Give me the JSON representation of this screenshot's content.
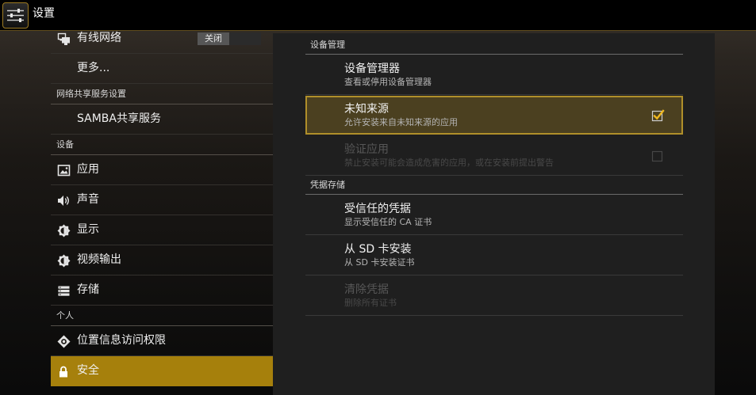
{
  "action_bar": {
    "title": "设置",
    "icon": "settings-icon"
  },
  "colors": {
    "accent": "#a6800c",
    "focus_border": "#b08f2a",
    "focus_fill": "#4b4020",
    "check": "#f0b820",
    "panel": "#1f1f1f",
    "action_bar": "#000000"
  },
  "sidebar": {
    "wired": {
      "label": "有线网络",
      "icon": "ethernet-icon",
      "switch_label": "关闭",
      "switch_on": false
    },
    "more": {
      "label": "更多..."
    },
    "sharing_header": "网络共享服务设置",
    "samba": {
      "label": "SAMBA共享服务"
    },
    "device_header": "设备",
    "apps": {
      "label": "应用",
      "icon": "picture-icon"
    },
    "sound": {
      "label": "声音",
      "icon": "speaker-icon"
    },
    "display": {
      "label": "显示",
      "icon": "brightness-icon"
    },
    "video_output": {
      "label": "视频输出",
      "icon": "video-output-icon"
    },
    "storage": {
      "label": "存储",
      "icon": "storage-icon"
    },
    "personal_header": "个人",
    "location": {
      "label": "位置信息访问权限",
      "icon": "location-icon"
    },
    "security": {
      "label": "安全",
      "icon": "lock-icon",
      "selected": true
    }
  },
  "security_panel": {
    "device_admin_header": "设备管理",
    "device_admins": {
      "title": "设备管理器",
      "summary": "查看或停用设备管理器",
      "enabled": true
    },
    "unknown_sources": {
      "title": "未知来源",
      "summary": "允许安装来自未知来源的应用",
      "checked": true,
      "focused": true,
      "enabled": true
    },
    "verify_apps": {
      "title": "验证应用",
      "summary": "禁止安装可能会造成危害的应用，或在安装前提出警告",
      "checked": false,
      "enabled": false
    },
    "credential_header": "凭据存储",
    "trusted_credentials": {
      "title": "受信任的凭据",
      "summary": "显示受信任的 CA 证书",
      "enabled": true
    },
    "install_from_sd": {
      "title": "从 SD 卡安装",
      "summary": "从 SD 卡安装证书",
      "enabled": true
    },
    "clear_credentials": {
      "title": "清除凭据",
      "summary": "删除所有证书",
      "enabled": false
    }
  }
}
